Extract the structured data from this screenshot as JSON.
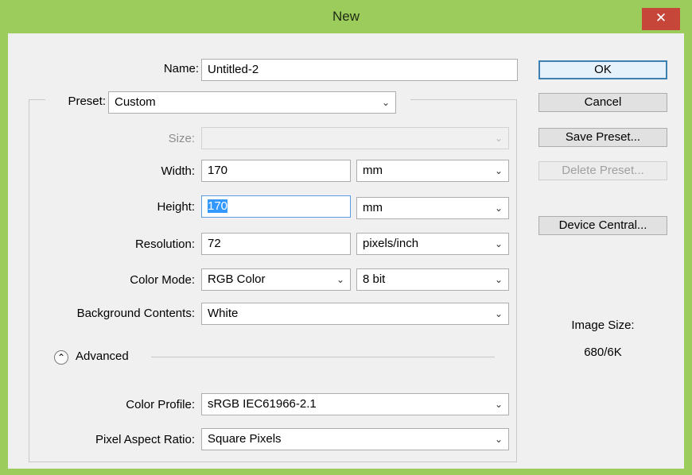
{
  "window": {
    "title": "New",
    "close_glyph": "✕",
    "accent": "#9ccc5c",
    "close_color": "#c7463a"
  },
  "form": {
    "name_label": "Name:",
    "name_value": "Untitled-2",
    "preset_label": "Preset:",
    "preset_value": "Custom",
    "size_label": "Size:",
    "size_value": "",
    "width_label": "Width:",
    "width_value": "170",
    "width_unit": "mm",
    "height_label": "Height:",
    "height_value": "170",
    "height_unit": "mm",
    "resolution_label": "Resolution:",
    "resolution_value": "72",
    "resolution_unit": "pixels/inch",
    "color_mode_label": "Color Mode:",
    "color_mode_value": "RGB Color",
    "bit_depth_value": "8 bit",
    "bg_label": "Background Contents:",
    "bg_value": "White",
    "advanced_label": "Advanced",
    "advanced_icon": "⌃",
    "color_profile_label": "Color Profile:",
    "color_profile_value": "sRGB IEC61966-2.1",
    "pixel_aspect_label": "Pixel Aspect Ratio:",
    "pixel_aspect_value": "Square Pixels"
  },
  "buttons": {
    "ok": "OK",
    "cancel": "Cancel",
    "save_preset": "Save Preset...",
    "delete_preset": "Delete Preset...",
    "device_central": "Device Central..."
  },
  "info": {
    "image_size_label": "Image Size:",
    "image_size_value": "680/6K"
  },
  "icons": {
    "dropdown": "⌄"
  }
}
